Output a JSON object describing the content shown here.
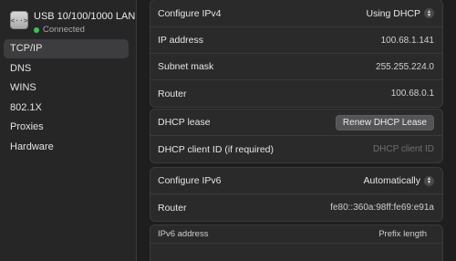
{
  "device": {
    "name": "USB 10/100/1000 LAN",
    "status": "Connected",
    "icon": "ethernet-icon",
    "status_color": "#34c759"
  },
  "sidebar": {
    "items": [
      {
        "label": "TCP/IP",
        "selected": true
      },
      {
        "label": "DNS"
      },
      {
        "label": "WINS"
      },
      {
        "label": "802.1X"
      },
      {
        "label": "Proxies"
      },
      {
        "label": "Hardware"
      }
    ]
  },
  "ipv4": {
    "configure_label": "Configure IPv4",
    "configure_value": "Using DHCP",
    "ip_label": "IP address",
    "ip_value": "100.68.1.141",
    "mask_label": "Subnet mask",
    "mask_value": "255.255.224.0",
    "router_label": "Router",
    "router_value": "100.68.0.1"
  },
  "dhcp": {
    "lease_label": "DHCP lease",
    "renew_button": "Renew DHCP Lease",
    "client_id_label": "DHCP client ID (if required)",
    "client_id_placeholder": "DHCP client ID"
  },
  "ipv6": {
    "configure_label": "Configure IPv6",
    "configure_value": "Automatically",
    "router_label": "Router",
    "router_value": "fe80::360a:98ff:fe69:e91a"
  },
  "ipv6_table": {
    "columns": [
      "IPv6 address",
      "Prefix length"
    ]
  }
}
